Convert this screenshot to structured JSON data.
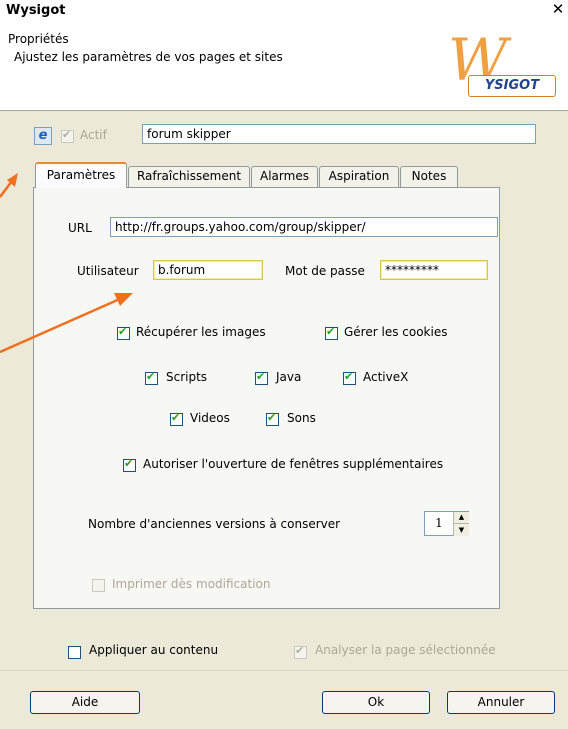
{
  "window": {
    "title": "Wysigot"
  },
  "header": {
    "title": "Propriétés",
    "subtitle": "Ajustez les paramètres de vos pages et sites",
    "logo_text": "YSIGOT",
    "logo_letter": "W"
  },
  "site": {
    "actif_label": "Actif",
    "name_value": "forum skipper"
  },
  "tabs": [
    {
      "label": "Paramètres"
    },
    {
      "label": "Rafraîchissement"
    },
    {
      "label": "Alarmes"
    },
    {
      "label": "Aspiration"
    },
    {
      "label": "Notes"
    }
  ],
  "params": {
    "url_label": "URL",
    "url_value": "http://fr.groups.yahoo.com/group/skipper/",
    "user_label": "Utilisateur",
    "user_value": "b.forum",
    "password_label": "Mot de passe",
    "password_value": "*********",
    "recuperer_images": "Récupérer les images",
    "gerer_cookies": "Gérer les cookies",
    "scripts": "Scripts",
    "java": "Java",
    "activex": "ActiveX",
    "videos": "Videos",
    "sons": "Sons",
    "autoriser": "Autoriser l'ouverture de fenêtres supplémentaires",
    "nombre_label": "Nombre d'anciennes versions à conserver",
    "nombre_value": "1",
    "imprimer": "Imprimer dès modification"
  },
  "footer": {
    "appliquer": "Appliquer au contenu",
    "analyser": "Analyser la page sélectionnée",
    "aide": "Aide",
    "ok": "Ok",
    "annuler": "Annuler"
  },
  "colors": {
    "arrow": "#f07020",
    "tab_accent": "#e68b2c"
  }
}
